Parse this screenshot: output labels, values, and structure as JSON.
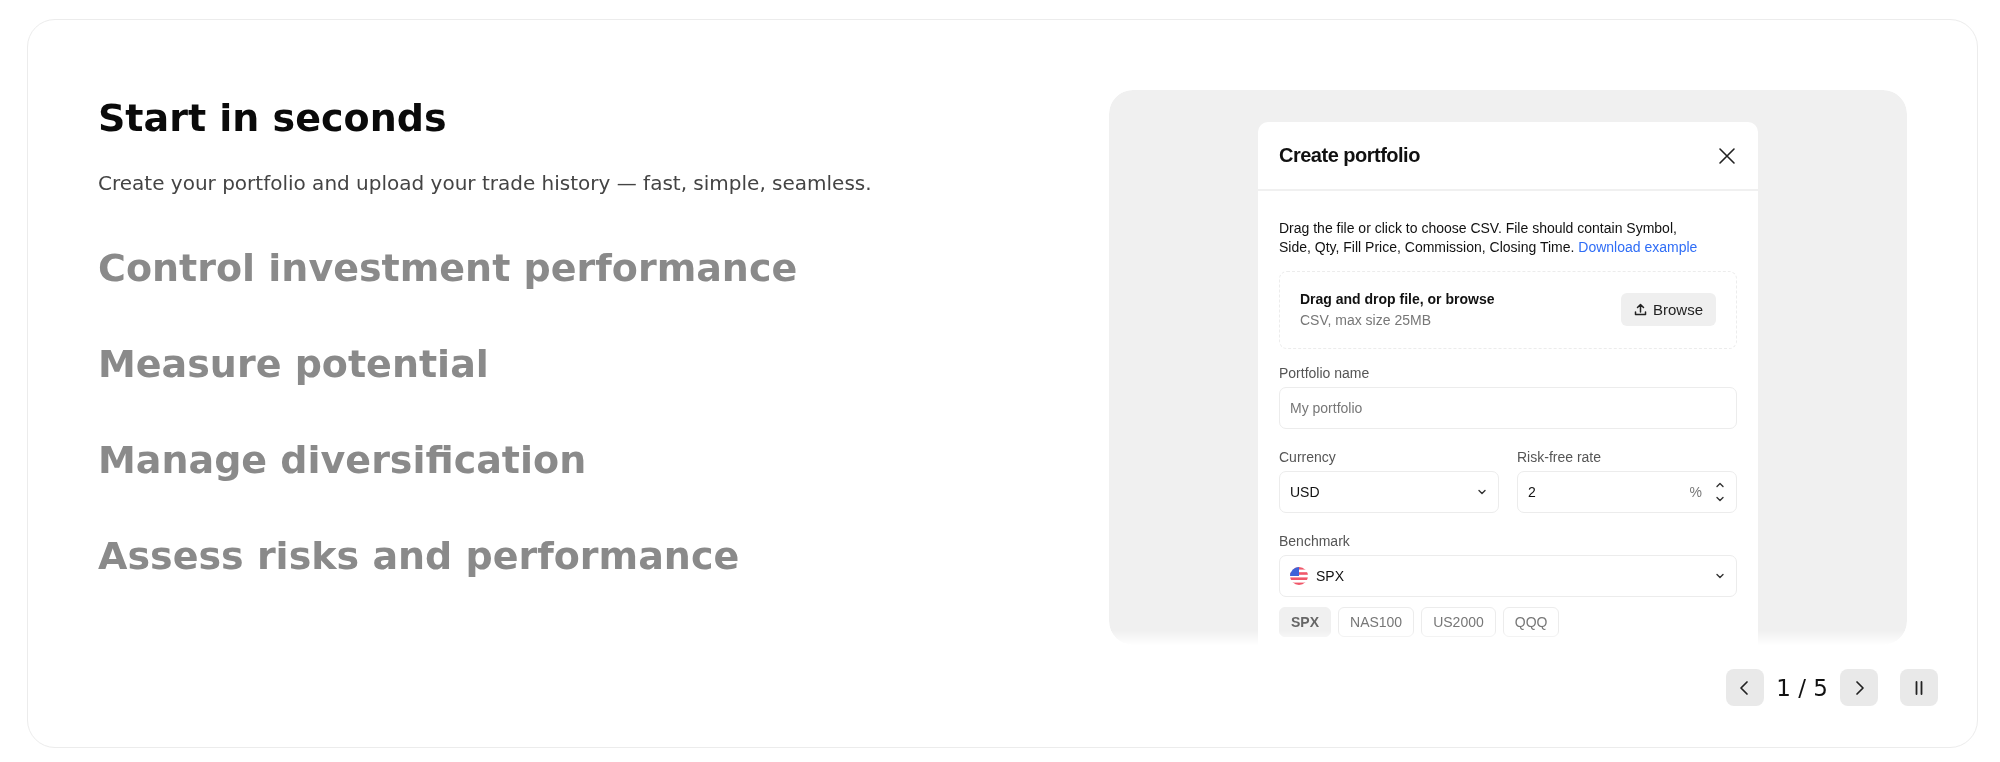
{
  "features": [
    {
      "title": "Start in seconds",
      "description": "Create your portfolio and upload your trade history — fast, simple, seamless.",
      "selected": true
    },
    {
      "title": "Control investment performance",
      "selected": false
    },
    {
      "title": "Measure potential",
      "selected": false
    },
    {
      "title": "Manage diversification",
      "selected": false
    },
    {
      "title": "Assess risks and performance",
      "selected": false
    }
  ],
  "dialog": {
    "title": "Create portfolio",
    "instructions": "Drag the file or click to choose CSV. File should contain Symbol, Side, Qty, Fill Price, Commission, Closing Time.",
    "download_link": "Download example",
    "dropzone": {
      "title": "Drag and drop file, or browse",
      "hint": "CSV, max size 25MB",
      "button": "Browse"
    },
    "portfolio_name": {
      "label": "Portfolio name",
      "placeholder": "My portfolio"
    },
    "currency": {
      "label": "Currency",
      "value": "USD"
    },
    "risk_free_rate": {
      "label": "Risk-free rate",
      "value": "2",
      "unit": "%"
    },
    "benchmark": {
      "label": "Benchmark",
      "value": "SPX"
    },
    "benchmark_chips": [
      {
        "label": "SPX",
        "selected": true
      },
      {
        "label": "NAS100",
        "selected": false
      },
      {
        "label": "US2000",
        "selected": false
      },
      {
        "label": "QQQ",
        "selected": false
      }
    ]
  },
  "pager": {
    "text": "1 / 5"
  }
}
